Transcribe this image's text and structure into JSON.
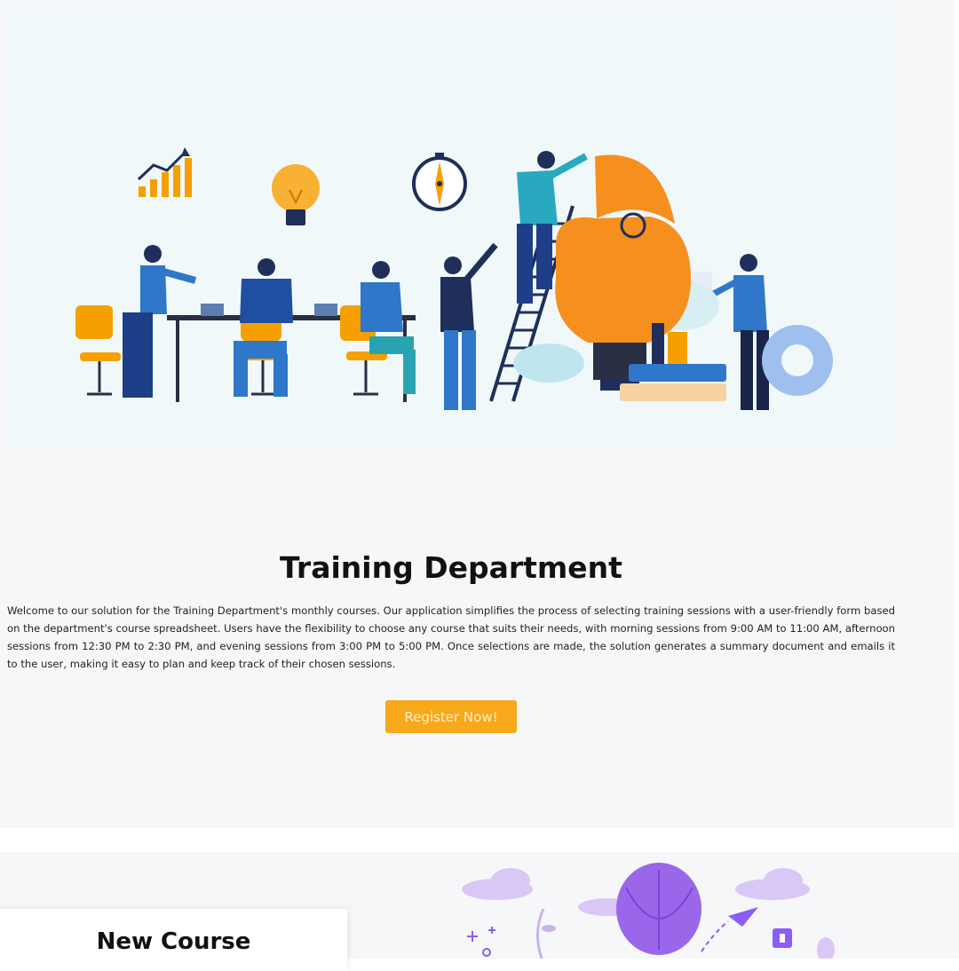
{
  "hero": {
    "title": "Training Department",
    "description": "Welcome to our solution for the Training Department's monthly courses. Our application simplifies the process of selecting training sessions with a user-friendly form based on the department's course spreadsheet. Users have the flexibility to choose any course that suits their needs, with morning sessions from 9:00 AM to 11:00 AM, afternoon sessions from 12:30 PM to 2:30 PM, and evening sessions from 3:00 PM to 5:00 PM. Once selections are made, the solution generates a summary document and emails it to the user, making it easy to plan and keep track of their chosen sessions.",
    "register_label": "Register Now!",
    "illustration": "team-training-lightbulb-illustration"
  },
  "new_course": {
    "title": "New Course",
    "illustration": "purple-lightbulb-balloon-illustration"
  },
  "colors": {
    "accent": "#f8a81b",
    "orange": "#f5a000",
    "blue": "#2e77c9",
    "navy": "#1f2e5a",
    "purple": "#8b5cf6",
    "page_bg": "#f5f7f9"
  }
}
